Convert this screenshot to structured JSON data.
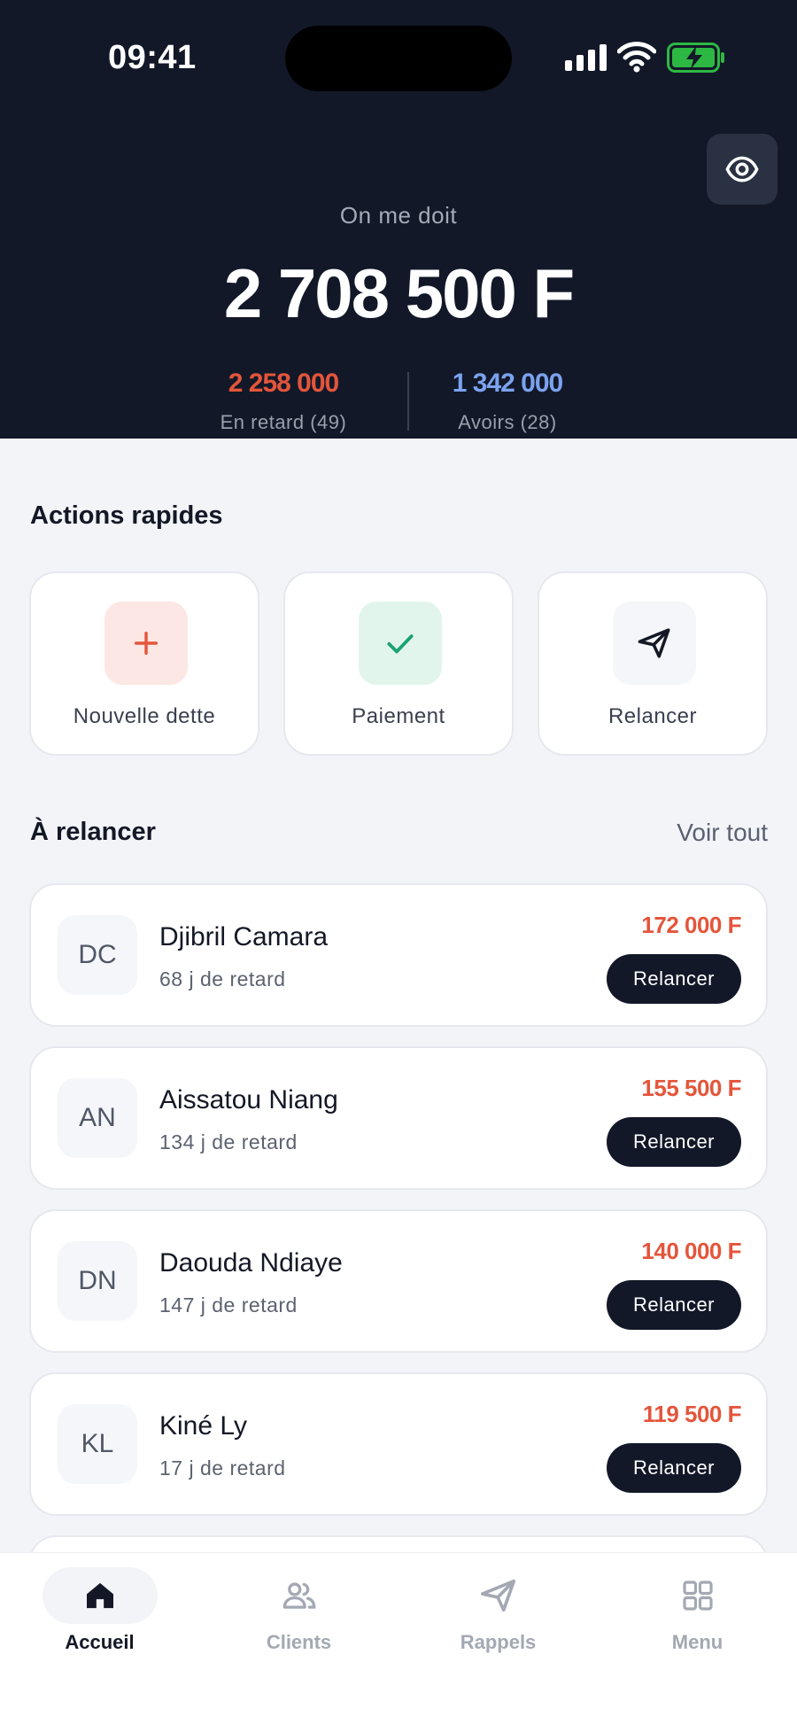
{
  "status_bar": {
    "time": "09:41"
  },
  "summary": {
    "label": "On me doit",
    "amount": "2 708 500 F",
    "overdue_value": "2 258 000",
    "overdue_label": "En retard (49)",
    "credits_value": "1 342 000",
    "credits_label": "Avoirs (28)"
  },
  "quick_actions": {
    "title": "Actions rapides",
    "items": [
      {
        "label": "Nouvelle dette",
        "icon": "plus-icon",
        "color": "#e4553b"
      },
      {
        "label": "Paiement",
        "icon": "check-icon",
        "color": "#1aa272"
      },
      {
        "label": "Relancer",
        "icon": "send-icon",
        "color": "#141826"
      }
    ]
  },
  "to_remind": {
    "title": "À relancer",
    "see_all": "Voir tout",
    "clients": [
      {
        "initials": "DC",
        "name": "Djibril Camara",
        "delay": "68 j de retard",
        "amount": "172 000 F",
        "action": "Relancer"
      },
      {
        "initials": "AN",
        "name": "Aissatou Niang",
        "delay": "134 j de retard",
        "amount": "155 500 F",
        "action": "Relancer"
      },
      {
        "initials": "DN",
        "name": "Daouda Ndiaye",
        "delay": "147 j de retard",
        "amount": "140 000 F",
        "action": "Relancer"
      },
      {
        "initials": "KL",
        "name": "Kiné Ly",
        "delay": "17 j de retard",
        "amount": "119 500 F",
        "action": "Relancer"
      }
    ]
  },
  "nav": {
    "items": [
      {
        "label": "Accueil",
        "icon": "home-icon",
        "active": true
      },
      {
        "label": "Clients",
        "icon": "users-icon",
        "active": false
      },
      {
        "label": "Rappels",
        "icon": "send-icon",
        "active": false
      },
      {
        "label": "Menu",
        "icon": "grid-icon",
        "active": false
      }
    ]
  },
  "colors": {
    "header_bg": "#121828",
    "overdue": "#e4553b",
    "credits": "#7ba2ee",
    "background": "#f3f4f8"
  }
}
